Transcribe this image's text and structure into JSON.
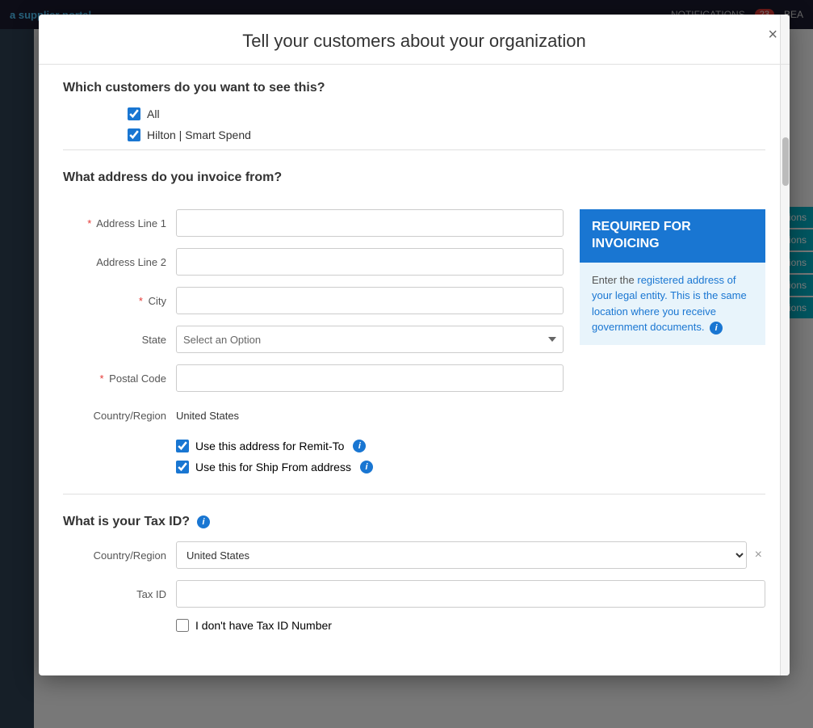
{
  "topNav": {
    "logo": "a supplier portal",
    "user": "BEA",
    "notifications_label": "NOTIFICATIONS",
    "notifications_count": "23"
  },
  "bgActions": {
    "items": [
      "Actions",
      "Actions",
      "Actions",
      "Actions",
      "Actions"
    ]
  },
  "modal": {
    "title": "Tell your customers about your organization",
    "close_label": "×",
    "sections": {
      "customers": {
        "title": "Which customers do you want to see this?",
        "options": [
          "All",
          "Hilton | Smart Spend"
        ]
      },
      "address": {
        "title": "What address do you invoice from?",
        "fields": {
          "address_line_1_label": "Address Line 1",
          "address_line_2_label": "Address Line 2",
          "city_label": "City",
          "state_label": "State",
          "state_placeholder": "Select an Option",
          "postal_code_label": "Postal Code",
          "country_label": "Country/Region",
          "country_value": "United States"
        },
        "checkboxes": {
          "remit_to_label": "Use this address for Remit-To",
          "ship_from_label": "Use this for Ship From address"
        },
        "info_box": {
          "header": "REQUIRED FOR INVOICING",
          "body": "Enter the registered address of your legal entity. This is the same location where you receive government documents.",
          "icon": "i"
        }
      },
      "tax": {
        "title": "What is your Tax ID?",
        "icon": "i",
        "fields": {
          "country_label": "Country/Region",
          "country_value": "United States",
          "tax_id_label": "Tax ID",
          "no_tax_id_label": "I don't have Tax ID Number"
        }
      }
    }
  }
}
